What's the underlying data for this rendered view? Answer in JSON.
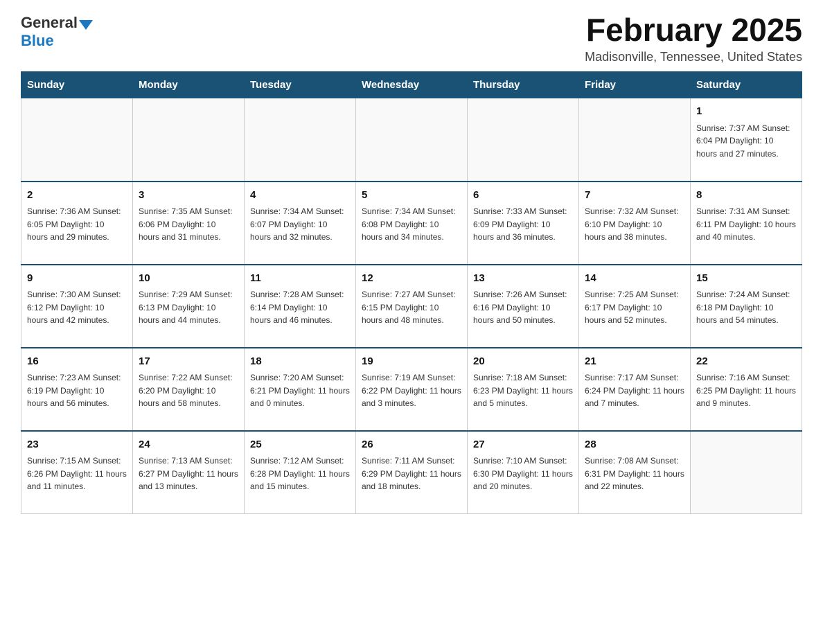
{
  "logo": {
    "general": "General",
    "blue": "Blue"
  },
  "title": "February 2025",
  "location": "Madisonville, Tennessee, United States",
  "days_of_week": [
    "Sunday",
    "Monday",
    "Tuesday",
    "Wednesday",
    "Thursday",
    "Friday",
    "Saturday"
  ],
  "weeks": [
    [
      {
        "day": "",
        "info": ""
      },
      {
        "day": "",
        "info": ""
      },
      {
        "day": "",
        "info": ""
      },
      {
        "day": "",
        "info": ""
      },
      {
        "day": "",
        "info": ""
      },
      {
        "day": "",
        "info": ""
      },
      {
        "day": "1",
        "info": "Sunrise: 7:37 AM\nSunset: 6:04 PM\nDaylight: 10 hours\nand 27 minutes."
      }
    ],
    [
      {
        "day": "2",
        "info": "Sunrise: 7:36 AM\nSunset: 6:05 PM\nDaylight: 10 hours\nand 29 minutes."
      },
      {
        "day": "3",
        "info": "Sunrise: 7:35 AM\nSunset: 6:06 PM\nDaylight: 10 hours\nand 31 minutes."
      },
      {
        "day": "4",
        "info": "Sunrise: 7:34 AM\nSunset: 6:07 PM\nDaylight: 10 hours\nand 32 minutes."
      },
      {
        "day": "5",
        "info": "Sunrise: 7:34 AM\nSunset: 6:08 PM\nDaylight: 10 hours\nand 34 minutes."
      },
      {
        "day": "6",
        "info": "Sunrise: 7:33 AM\nSunset: 6:09 PM\nDaylight: 10 hours\nand 36 minutes."
      },
      {
        "day": "7",
        "info": "Sunrise: 7:32 AM\nSunset: 6:10 PM\nDaylight: 10 hours\nand 38 minutes."
      },
      {
        "day": "8",
        "info": "Sunrise: 7:31 AM\nSunset: 6:11 PM\nDaylight: 10 hours\nand 40 minutes."
      }
    ],
    [
      {
        "day": "9",
        "info": "Sunrise: 7:30 AM\nSunset: 6:12 PM\nDaylight: 10 hours\nand 42 minutes."
      },
      {
        "day": "10",
        "info": "Sunrise: 7:29 AM\nSunset: 6:13 PM\nDaylight: 10 hours\nand 44 minutes."
      },
      {
        "day": "11",
        "info": "Sunrise: 7:28 AM\nSunset: 6:14 PM\nDaylight: 10 hours\nand 46 minutes."
      },
      {
        "day": "12",
        "info": "Sunrise: 7:27 AM\nSunset: 6:15 PM\nDaylight: 10 hours\nand 48 minutes."
      },
      {
        "day": "13",
        "info": "Sunrise: 7:26 AM\nSunset: 6:16 PM\nDaylight: 10 hours\nand 50 minutes."
      },
      {
        "day": "14",
        "info": "Sunrise: 7:25 AM\nSunset: 6:17 PM\nDaylight: 10 hours\nand 52 minutes."
      },
      {
        "day": "15",
        "info": "Sunrise: 7:24 AM\nSunset: 6:18 PM\nDaylight: 10 hours\nand 54 minutes."
      }
    ],
    [
      {
        "day": "16",
        "info": "Sunrise: 7:23 AM\nSunset: 6:19 PM\nDaylight: 10 hours\nand 56 minutes."
      },
      {
        "day": "17",
        "info": "Sunrise: 7:22 AM\nSunset: 6:20 PM\nDaylight: 10 hours\nand 58 minutes."
      },
      {
        "day": "18",
        "info": "Sunrise: 7:20 AM\nSunset: 6:21 PM\nDaylight: 11 hours\nand 0 minutes."
      },
      {
        "day": "19",
        "info": "Sunrise: 7:19 AM\nSunset: 6:22 PM\nDaylight: 11 hours\nand 3 minutes."
      },
      {
        "day": "20",
        "info": "Sunrise: 7:18 AM\nSunset: 6:23 PM\nDaylight: 11 hours\nand 5 minutes."
      },
      {
        "day": "21",
        "info": "Sunrise: 7:17 AM\nSunset: 6:24 PM\nDaylight: 11 hours\nand 7 minutes."
      },
      {
        "day": "22",
        "info": "Sunrise: 7:16 AM\nSunset: 6:25 PM\nDaylight: 11 hours\nand 9 minutes."
      }
    ],
    [
      {
        "day": "23",
        "info": "Sunrise: 7:15 AM\nSunset: 6:26 PM\nDaylight: 11 hours\nand 11 minutes."
      },
      {
        "day": "24",
        "info": "Sunrise: 7:13 AM\nSunset: 6:27 PM\nDaylight: 11 hours\nand 13 minutes."
      },
      {
        "day": "25",
        "info": "Sunrise: 7:12 AM\nSunset: 6:28 PM\nDaylight: 11 hours\nand 15 minutes."
      },
      {
        "day": "26",
        "info": "Sunrise: 7:11 AM\nSunset: 6:29 PM\nDaylight: 11 hours\nand 18 minutes."
      },
      {
        "day": "27",
        "info": "Sunrise: 7:10 AM\nSunset: 6:30 PM\nDaylight: 11 hours\nand 20 minutes."
      },
      {
        "day": "28",
        "info": "Sunrise: 7:08 AM\nSunset: 6:31 PM\nDaylight: 11 hours\nand 22 minutes."
      },
      {
        "day": "",
        "info": ""
      }
    ]
  ]
}
